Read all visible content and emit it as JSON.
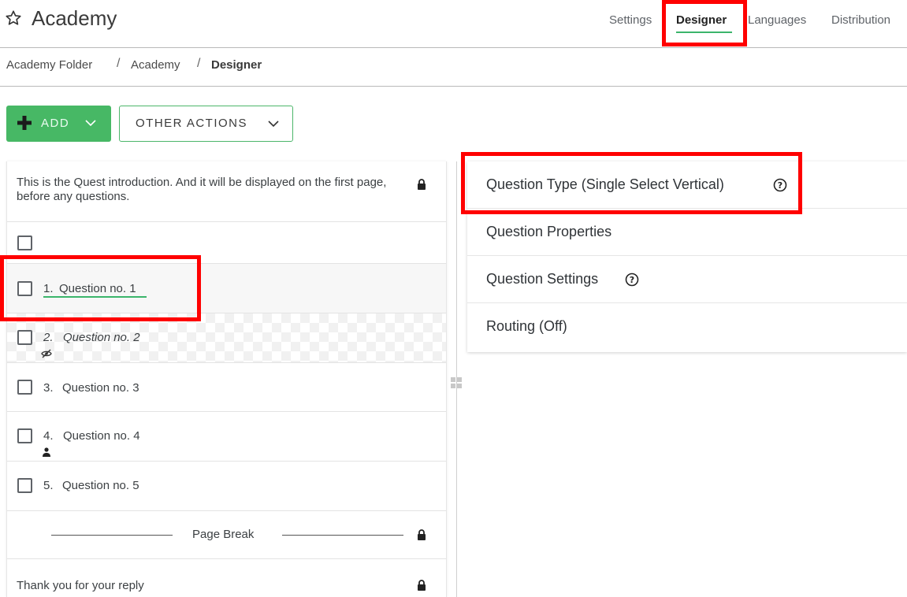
{
  "header": {
    "title": "Academy",
    "nav": {
      "settings": "Settings",
      "designer": "Designer",
      "languages": "Languages",
      "distribution": "Distribution"
    }
  },
  "breadcrumb": {
    "items": [
      "Academy Folder",
      "Academy",
      "Designer"
    ],
    "separator": "/"
  },
  "toolbar": {
    "add_label": "ADD",
    "other_label": "OTHER ACTIONS"
  },
  "questions": {
    "intro": "This is the Quest introduction. And it will be displayed on the first page, before any questions.",
    "items": [
      {
        "number": "1.",
        "label": "Question no. 1"
      },
      {
        "number": "2.",
        "label": "Question no. 2"
      },
      {
        "number": "3.",
        "label": "Question no. 3"
      },
      {
        "number": "4.",
        "label": "Question no. 4"
      },
      {
        "number": "5.",
        "label": "Question no. 5"
      }
    ],
    "page_break": "Page Break",
    "thank_you": "Thank you for your reply"
  },
  "panel": {
    "question_type": "Question Type (Single Select Vertical)",
    "question_properties": "Question Properties",
    "question_settings": "Question Settings",
    "routing": "Routing (Off)"
  },
  "colors": {
    "accent_green": "#47b865",
    "highlight_red": "#ff0000",
    "underline_green": "#3bb56b"
  }
}
